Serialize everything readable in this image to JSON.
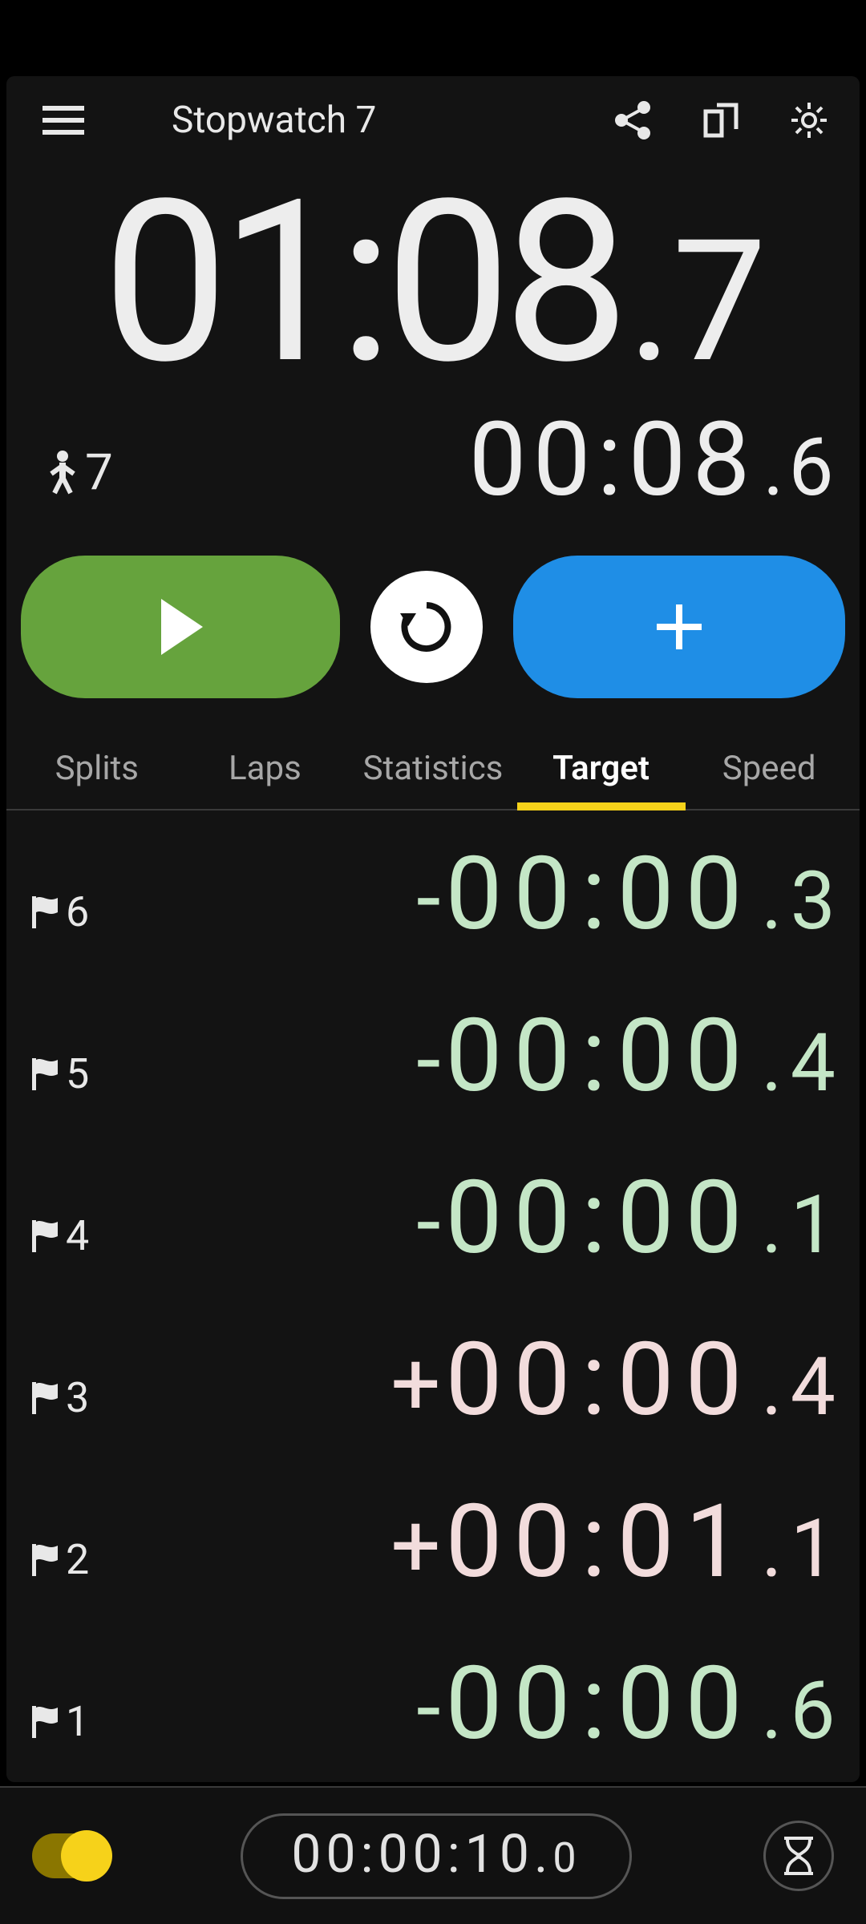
{
  "appbar": {
    "title": "Stopwatch 7"
  },
  "timer": {
    "main_mmss": "01:08",
    "main_tenth": "7",
    "runner_count": "7",
    "lap_mmss": "00:08",
    "lap_tenth": "6"
  },
  "tabs": {
    "splits": "Splits",
    "laps": "Laps",
    "statistics": "Statistics",
    "target": "Target",
    "speed": "Speed",
    "active": "target"
  },
  "rows": [
    {
      "index": "6",
      "sign": "-",
      "mmss": "00:00",
      "tenth": "3",
      "tone": "neg"
    },
    {
      "index": "5",
      "sign": "-",
      "mmss": "00:00",
      "tenth": "4",
      "tone": "neg"
    },
    {
      "index": "4",
      "sign": "-",
      "mmss": "00:00",
      "tenth": "1",
      "tone": "neg"
    },
    {
      "index": "3",
      "sign": "+",
      "mmss": "00:00",
      "tenth": "4",
      "tone": "pos"
    },
    {
      "index": "2",
      "sign": "+",
      "mmss": "00:01",
      "tenth": "1",
      "tone": "pos"
    },
    {
      "index": "1",
      "sign": "-",
      "mmss": "00:00",
      "tenth": "6",
      "tone": "neg"
    }
  ],
  "footer": {
    "target_main": "00:00:10",
    "target_tenth": "0"
  }
}
